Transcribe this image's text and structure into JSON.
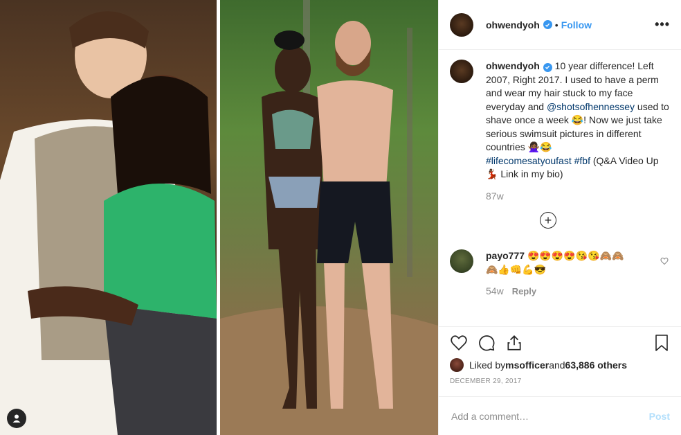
{
  "header": {
    "username": "ohwendyoh",
    "separator": "•",
    "follow_label": "Follow",
    "more_label": "•••"
  },
  "caption": {
    "username": "ohwendyoh",
    "text_1": "10 year difference! Left 2007, Right 2017. I used to have a perm and wear my hair stuck to my face everyday and ",
    "mention": "@shotsofhennessey",
    "text_2": " used to shave once a week 😂! Now we just take serious swimsuit pictures in different countries 🙅🏾‍♀️😂",
    "hashtag_1": "#lifecomesatyoufast",
    "hashtag_2": "#fbf",
    "text_3": " (Q&A Video Up 💃🏾 Link in my bio)",
    "age": "87w"
  },
  "load_more_label": "+",
  "comment": {
    "username": "payo777",
    "emojis_line1": "😍😍😍😍😘😘🙈🙈",
    "emojis_line2": "🙈👍👊💪😎",
    "age": "54w",
    "reply_label": "Reply"
  },
  "likes": {
    "prefix": "Liked by ",
    "liker": "msofficer",
    "middle": " and ",
    "others": "63,886 others"
  },
  "date": "DECEMBER 29, 2017",
  "add_comment": {
    "placeholder": "Add a comment…",
    "post_label": "Post"
  },
  "colors": {
    "accent": "#3897f0",
    "link": "#00376b",
    "muted": "#8e8e8e",
    "post_disabled": "#b2dffc"
  },
  "icons": [
    "user-tag-icon",
    "verified-icon",
    "more-icon",
    "plus-circle-icon",
    "heart-icon",
    "comment-icon",
    "share-icon",
    "bookmark-icon"
  ]
}
